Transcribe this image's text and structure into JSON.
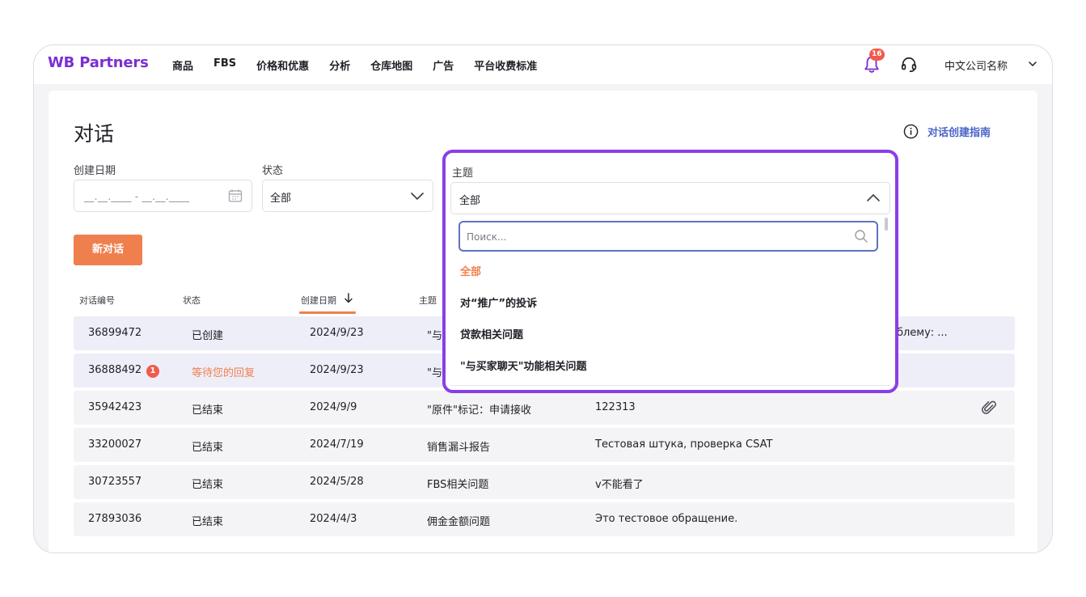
{
  "header": {
    "logo": "WB Partners",
    "nav": [
      "商品",
      "FBS",
      "价格和优惠",
      "分析",
      "仓库地图",
      "广告",
      "平台收费标准"
    ],
    "notification_count": "16",
    "company": "中文公司名称"
  },
  "page": {
    "title": "对话",
    "guide_link": "对话创建指南",
    "new_button": "新对话"
  },
  "filters": {
    "date": {
      "label": "创建日期",
      "value": "__.__.____ - __.__.____"
    },
    "status": {
      "label": "状态",
      "value": "全部"
    },
    "topic": {
      "label": "主题",
      "value": "全部",
      "search_placeholder": "Поиск...",
      "options": [
        "全部",
        "对“推广”的投诉",
        "贷款相关问题",
        "\"与买家聊天\"功能相关问题"
      ],
      "selected_index": 0
    }
  },
  "table": {
    "headers": [
      "对话编号",
      "状态",
      "创建日期",
      "主题"
    ],
    "sorted_column": "创建日期",
    "rows": [
      {
        "id": "36899472",
        "status": "已创建",
        "date": "2024/9/23",
        "topic": "\"与",
        "desc": "облему: ...",
        "badge": "",
        "attachment": false
      },
      {
        "id": "36888492",
        "status": "等待您的回复",
        "date": "2024/9/23",
        "topic": "\"与",
        "desc": "",
        "badge": "1",
        "attachment": false
      },
      {
        "id": "35942423",
        "status": "已结束",
        "date": "2024/9/9",
        "topic": "\"原件\"标记：申请接收",
        "desc": "122313",
        "badge": "",
        "attachment": true
      },
      {
        "id": "33200027",
        "status": "已结束",
        "date": "2024/7/19",
        "topic": "销售漏斗报告",
        "desc": "Тестовая штука, проверка CSAT",
        "badge": "",
        "attachment": false
      },
      {
        "id": "30723557",
        "status": "已结束",
        "date": "2024/5/28",
        "topic": "FBS相关问题",
        "desc": "v不能看了",
        "badge": "",
        "attachment": false
      },
      {
        "id": "27893036",
        "status": "已结束",
        "date": "2024/4/3",
        "topic": "佣金金额问题",
        "desc": "Это тестовое обращение.",
        "badge": "",
        "attachment": false
      }
    ]
  },
  "colors": {
    "brand": "#7b2fd1",
    "accent": "#f07f4e",
    "link": "#4a64c7",
    "highlight": "#8a3ee6"
  }
}
